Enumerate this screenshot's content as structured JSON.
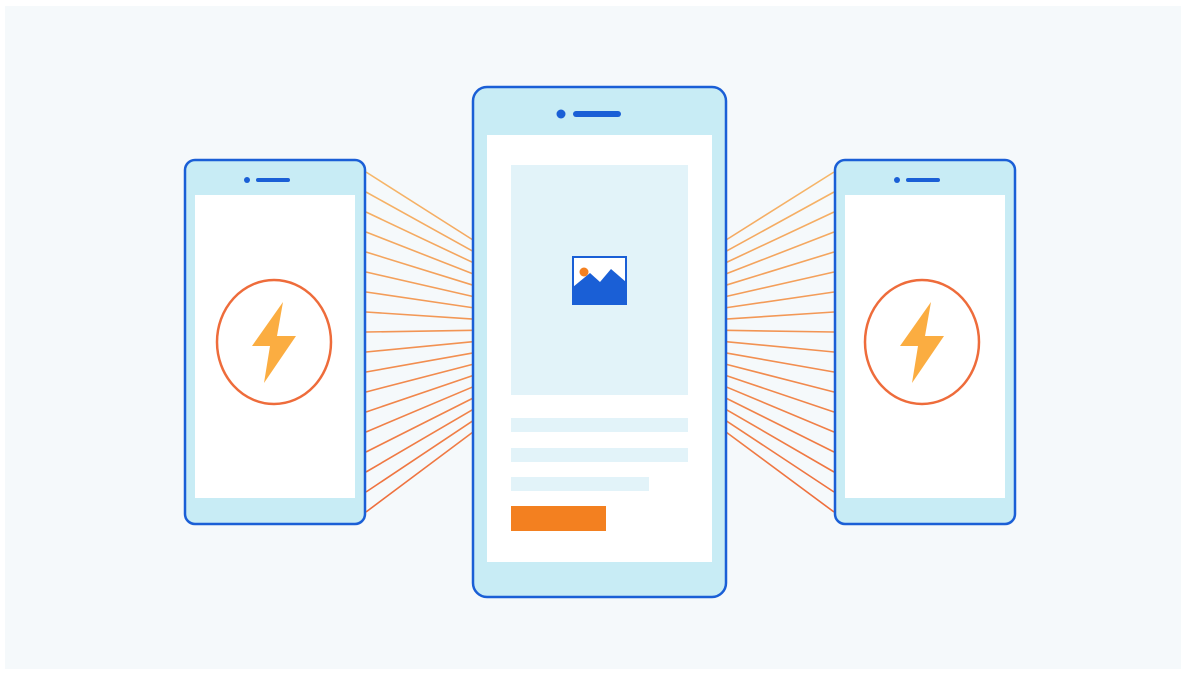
{
  "illustration": {
    "phones": [
      {
        "id": "left",
        "screen": "lightning-circle"
      },
      {
        "id": "center",
        "screen": "content-page"
      },
      {
        "id": "right",
        "screen": "lightning-circle"
      }
    ],
    "center_screen": {
      "text_lines": 3,
      "button": "orange-button"
    },
    "icons": [
      "lightning-icon",
      "image-icon",
      "camera-dot-icon",
      "speaker-icon"
    ],
    "colors": {
      "background": "#f5f9fb",
      "phone_body": "#c8ecf5",
      "phone_outline": "#1a5fd6",
      "screen": "#ffffff",
      "placeholder": "#e2f3f9",
      "accent_orange": "#f38020",
      "ring": "#ee6c3b",
      "bolt": "#fbad41",
      "ray_top": "#f6b86a",
      "ray_bottom": "#ee6c3b"
    }
  }
}
